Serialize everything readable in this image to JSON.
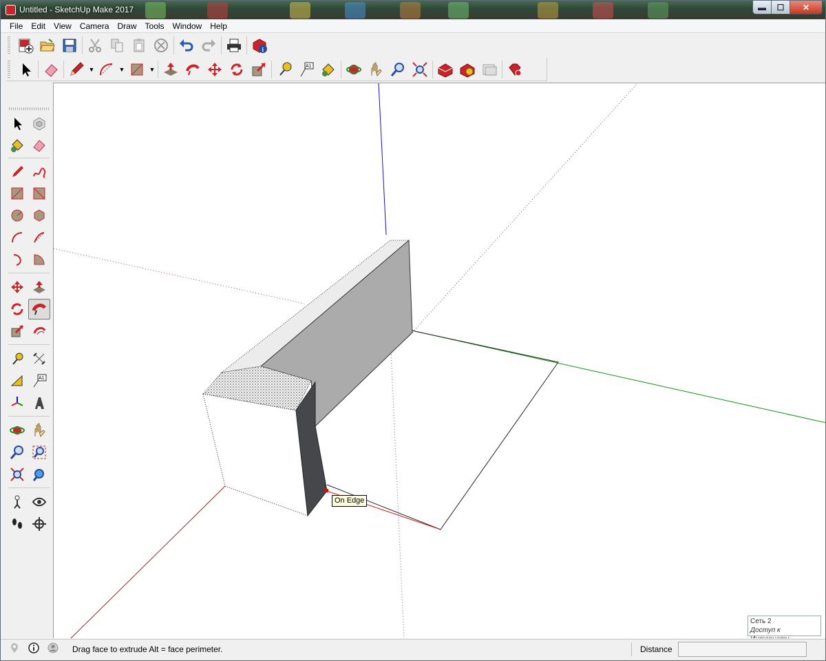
{
  "window": {
    "title": "Untitled - SketchUp Make 2017",
    "controls": {
      "minimize": "▬",
      "maximize": "☐",
      "close": "✕"
    }
  },
  "menu": [
    "File",
    "Edit",
    "View",
    "Camera",
    "Draw",
    "Tools",
    "Window",
    "Help"
  ],
  "toolbar_main": [
    "new-icon",
    "open-icon",
    "save-icon",
    "cut-icon",
    "copy-icon",
    "paste-icon",
    "erase-icon",
    "undo-icon",
    "redo-icon",
    "print-icon",
    "model-info-icon"
  ],
  "toolbar_large": [
    "select-icon",
    "eraser-icon",
    "pencil-icon",
    "arc-icon",
    "rectangle-icon",
    "push-pull-icon",
    "follow-me-icon",
    "move-icon",
    "rotate-icon",
    "scale-icon",
    "tape-measure-icon",
    "text-icon",
    "paint-bucket-icon",
    "orbit-icon",
    "pan-icon",
    "zoom-icon",
    "zoom-extents-icon",
    "warehouse-icon",
    "extension-icon",
    "send-to-layout-icon",
    "ruby-icon"
  ],
  "viewport": {
    "inference_tooltip": "On Edge",
    "axis_colors": {
      "red": "#d01010",
      "green": "#109010",
      "blue": "#1010c0"
    }
  },
  "network_tooltip": {
    "line1": "Сеть  2",
    "line2": "Доступ к Интернету"
  },
  "status": {
    "message": "Drag face to extrude  Alt = face perimeter.",
    "measurements_label": "Distance",
    "measurements_value": ""
  }
}
